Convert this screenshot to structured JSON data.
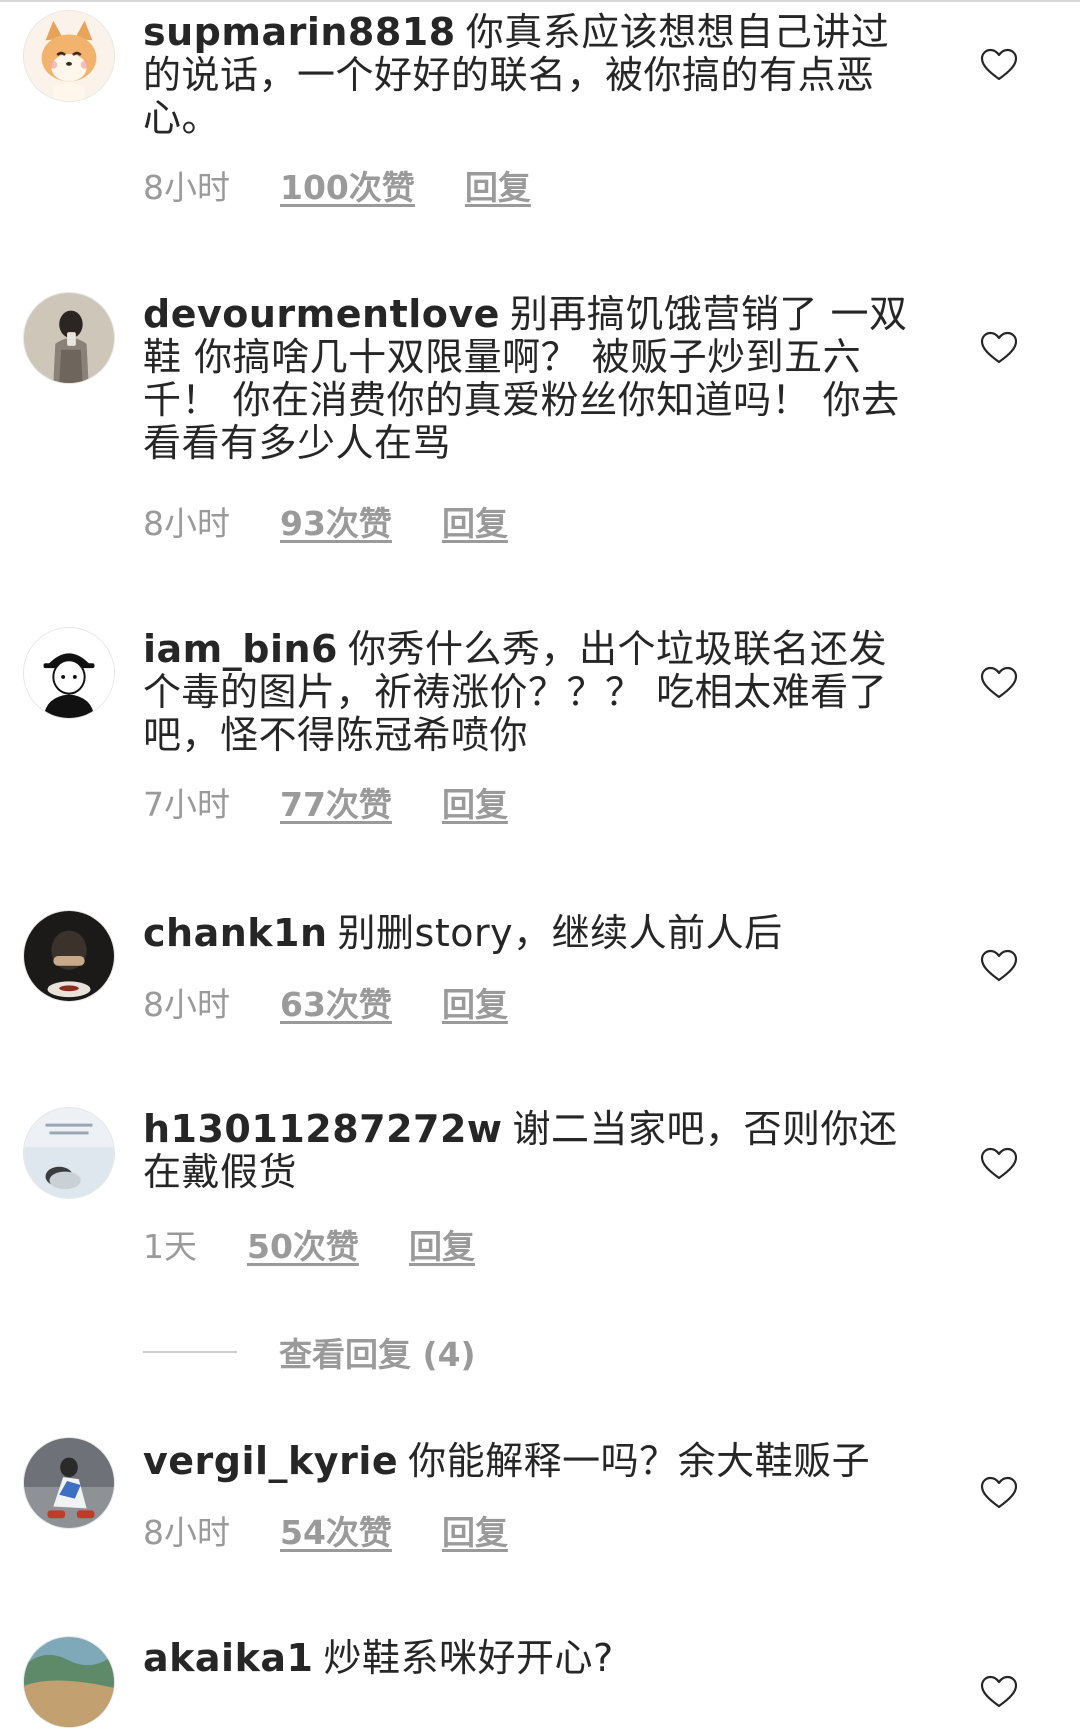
{
  "comments": [
    {
      "username": "supmarin8818",
      "text": "你真系应该想想自己讲过的说话，一个好好的联名，被你搞的有点恶心。",
      "time": "8小时",
      "likes": "100次赞",
      "reply": "回复"
    },
    {
      "username": "devourmentlove",
      "text": "别再搞饥饿营销了 一双鞋 你搞啥几十双限量啊？ 被贩子炒到五六千！ 你在消费你的真爱粉丝你知道吗！ 你去看看有多少人在骂",
      "time": "8小时",
      "likes": "93次赞",
      "reply": "回复"
    },
    {
      "username": "iam_bin6",
      "text": "你秀什么秀，出个垃圾联名还发个毒的图片，祈祷涨价？？？ 吃相太难看了吧，怪不得陈冠希喷你",
      "time": "7小时",
      "likes": "77次赞",
      "reply": "回复"
    },
    {
      "username": "chank1n",
      "text": "别删story，继续人前人后",
      "time": "8小时",
      "likes": "63次赞",
      "reply": "回复"
    },
    {
      "username": "h13011287272w",
      "text": "谢二当家吧，否则你还在戴假货",
      "time": "1天",
      "likes": "50次赞",
      "reply": "回复"
    },
    {
      "username": "vergil_kyrie",
      "text": "你能解释一吗？余大鞋贩子",
      "time": "8小时",
      "likes": "54次赞",
      "reply": "回复"
    },
    {
      "username": "akaika1",
      "text": "炒鞋系咪好开心?",
      "time": "",
      "likes": "",
      "reply": ""
    }
  ],
  "view_replies": "查看回复 (4)",
  "icons": {
    "like": "heart-outline-icon"
  },
  "colors": {
    "text": "#262626",
    "meta": "#9a9a9a",
    "heart": "#262626"
  }
}
